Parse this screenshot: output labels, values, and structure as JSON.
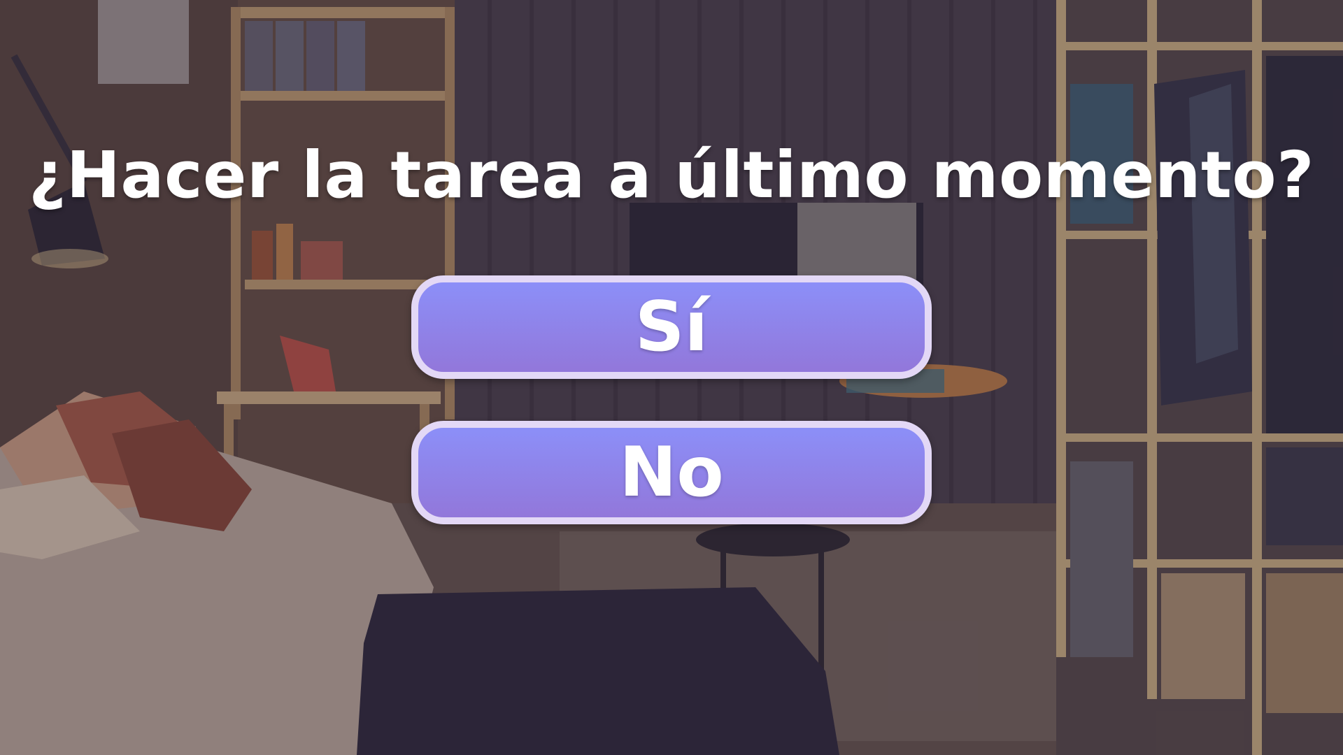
{
  "question": {
    "text": "¿Hacer la tarea a último momento?"
  },
  "choices": [
    {
      "label": "Sí"
    },
    {
      "label": "No"
    }
  ],
  "colors": {
    "button_top": "#8c8ff8",
    "button_bottom": "#9277da",
    "button_border": "#e3d8f6",
    "text": "#ffffff"
  },
  "background": {
    "scene": "bedroom-interior"
  }
}
